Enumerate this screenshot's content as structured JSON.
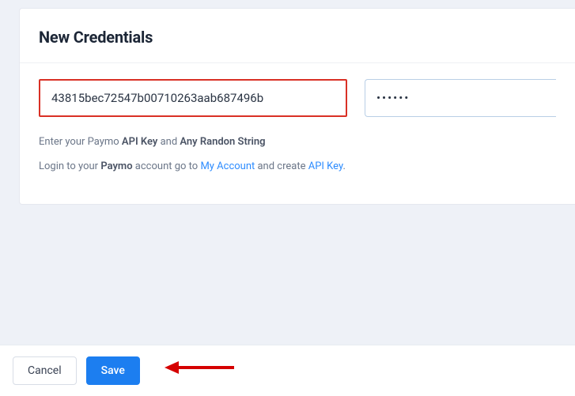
{
  "header": {
    "title": "New Credentials"
  },
  "fields": {
    "api_key_value": "43815bec72547b00710263aab687496b",
    "password_value": "••••••"
  },
  "help1": {
    "pre": "Enter your Paymo ",
    "b1": "API Key",
    "mid": " and ",
    "b2": "Any Randon String"
  },
  "help2": {
    "pre": "Login to your ",
    "b1": "Paymo",
    "mid1": " account go to ",
    "link1": "My Account",
    "mid2": " and create ",
    "link2": "API Key",
    "end": "."
  },
  "footer": {
    "cancel_label": "Cancel",
    "save_label": "Save"
  }
}
